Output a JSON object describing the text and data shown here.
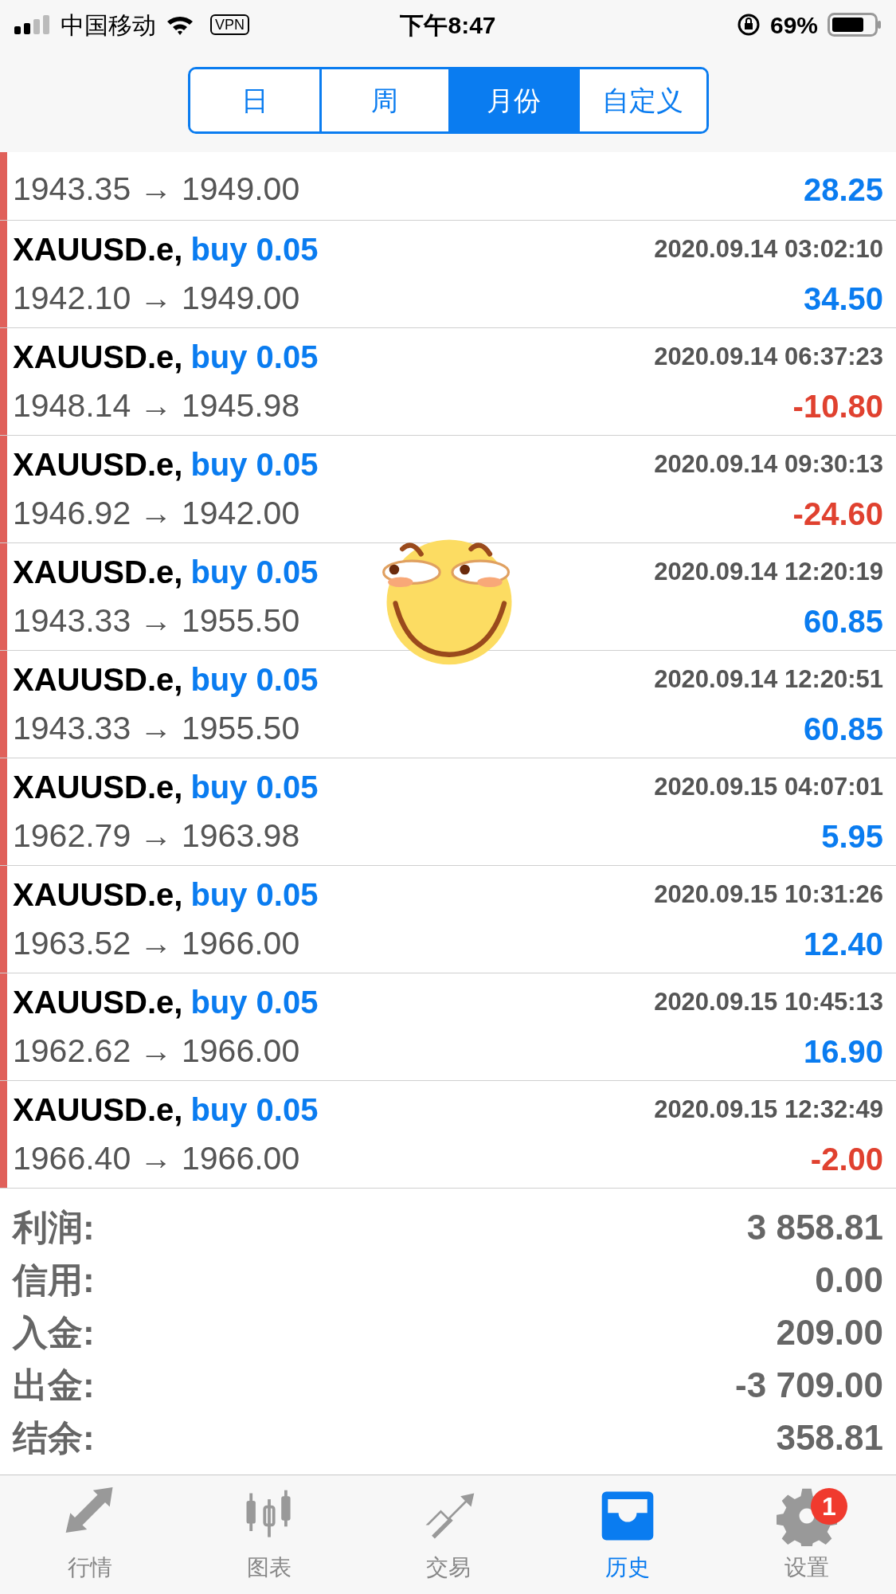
{
  "status_bar": {
    "carrier": "中国移动",
    "vpn": "VPN",
    "time": "下午8:47",
    "battery": "69%"
  },
  "segments": [
    {
      "label": "日",
      "selected": false
    },
    {
      "label": "周",
      "selected": false
    },
    {
      "label": "月份",
      "selected": true
    },
    {
      "label": "自定义",
      "selected": false
    }
  ],
  "partial_row": {
    "prices": "1943.35 → 1949.00",
    "profit": "28.25",
    "kind": "gain"
  },
  "trades": [
    {
      "symbol": "XAUUSD.e,",
      "order": "buy 0.05",
      "time": "2020.09.14 03:02:10",
      "prices": "1942.10 → 1949.00",
      "profit": "34.50",
      "kind": "gain"
    },
    {
      "symbol": "XAUUSD.e,",
      "order": "buy 0.05",
      "time": "2020.09.14 06:37:23",
      "prices": "1948.14 → 1945.98",
      "profit": "-10.80",
      "kind": "loss"
    },
    {
      "symbol": "XAUUSD.e,",
      "order": "buy 0.05",
      "time": "2020.09.14 09:30:13",
      "prices": "1946.92 → 1942.00",
      "profit": "-24.60",
      "kind": "loss"
    },
    {
      "symbol": "XAUUSD.e,",
      "order": "buy 0.05",
      "time": "2020.09.14 12:20:19",
      "prices": "1943.33 → 1955.50",
      "profit": "60.85",
      "kind": "gain"
    },
    {
      "symbol": "XAUUSD.e,",
      "order": "buy 0.05",
      "time": "2020.09.14 12:20:51",
      "prices": "1943.33 → 1955.50",
      "profit": "60.85",
      "kind": "gain"
    },
    {
      "symbol": "XAUUSD.e,",
      "order": "buy 0.05",
      "time": "2020.09.15 04:07:01",
      "prices": "1962.79 → 1963.98",
      "profit": "5.95",
      "kind": "gain"
    },
    {
      "symbol": "XAUUSD.e,",
      "order": "buy 0.05",
      "time": "2020.09.15 10:31:26",
      "prices": "1963.52 → 1966.00",
      "profit": "12.40",
      "kind": "gain"
    },
    {
      "symbol": "XAUUSD.e,",
      "order": "buy 0.05",
      "time": "2020.09.15 10:45:13",
      "prices": "1962.62 → 1966.00",
      "profit": "16.90",
      "kind": "gain"
    },
    {
      "symbol": "XAUUSD.e,",
      "order": "buy 0.05",
      "time": "2020.09.15 12:32:49",
      "prices": "1966.40 → 1966.00",
      "profit": "-2.00",
      "kind": "loss"
    }
  ],
  "summary": [
    {
      "label": "利润:",
      "value": "3 858.81"
    },
    {
      "label": "信用:",
      "value": "0.00"
    },
    {
      "label": "入金:",
      "value": "209.00"
    },
    {
      "label": "出金:",
      "value": "-3 709.00"
    },
    {
      "label": "结余:",
      "value": "358.81"
    }
  ],
  "tabs": [
    {
      "label": "行情",
      "kind": "quotes",
      "selected": false
    },
    {
      "label": "图表",
      "kind": "chart",
      "selected": false
    },
    {
      "label": "交易",
      "kind": "trade",
      "selected": false
    },
    {
      "label": "历史",
      "kind": "history",
      "selected": true
    },
    {
      "label": "设置",
      "kind": "settings",
      "selected": false,
      "badge": "1"
    }
  ]
}
